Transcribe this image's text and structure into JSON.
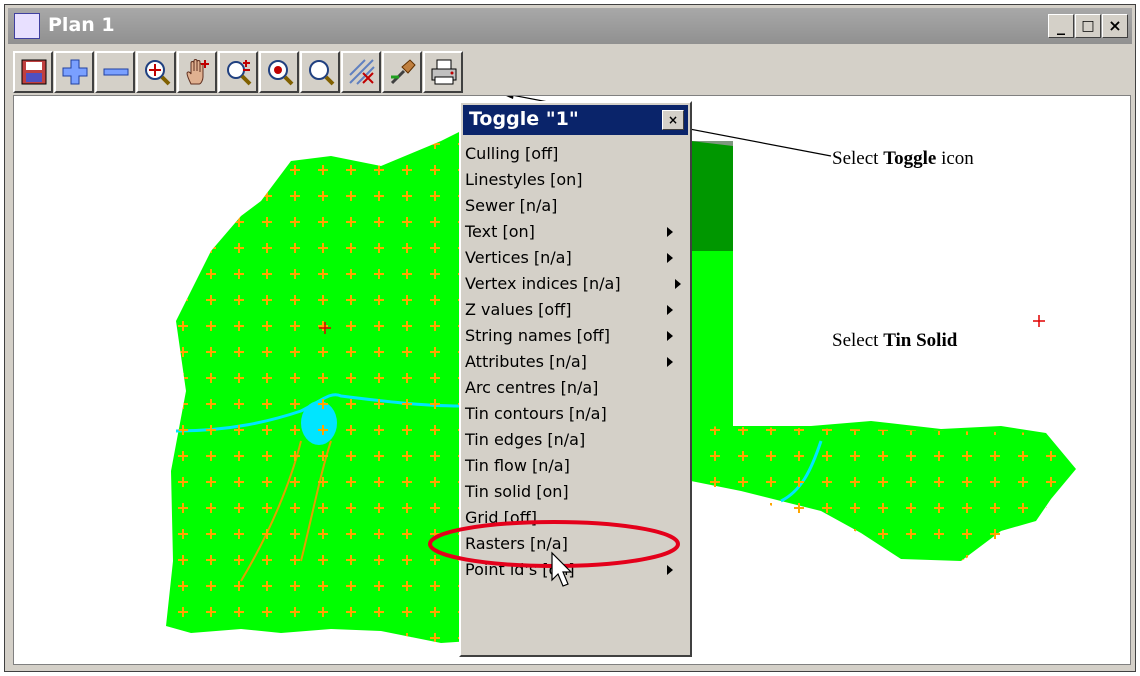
{
  "window": {
    "title": "Plan 1",
    "controls": [
      "_",
      "□",
      "×"
    ]
  },
  "toolbar": {
    "buttons": [
      {
        "name": "save-icon"
      },
      {
        "name": "zoom-in-plus-icon"
      },
      {
        "name": "zoom-out-minus-icon"
      },
      {
        "name": "zoom-extent-icon"
      },
      {
        "name": "pan-hand-icon"
      },
      {
        "name": "zoom-step-icon"
      },
      {
        "name": "zoom-center-icon"
      },
      {
        "name": "zoom-magnify-icon"
      },
      {
        "name": "toggle-icon"
      },
      {
        "name": "tool-icon"
      },
      {
        "name": "print-icon"
      }
    ]
  },
  "menu": {
    "title": "Toggle \"1\"",
    "close": "×",
    "items": [
      {
        "label": "Culling [off]",
        "submenu": false
      },
      {
        "label": "Linestyles [on]",
        "submenu": false
      },
      {
        "label": "Sewer [n/a]",
        "submenu": false
      },
      {
        "label": "Text [on]",
        "submenu": true
      },
      {
        "label": "Vertices [n/a]",
        "submenu": true
      },
      {
        "label": "Vertex indices [n/a]",
        "submenu": true
      },
      {
        "label": "Z values [off]",
        "submenu": true
      },
      {
        "label": "String names [off]",
        "submenu": true
      },
      {
        "label": "Attributes [n/a]",
        "submenu": true
      },
      {
        "label": "Arc centres [n/a]",
        "submenu": false
      },
      {
        "label": "Tin contours [n/a]",
        "submenu": false
      },
      {
        "label": "Tin edges [n/a]",
        "submenu": false
      },
      {
        "label": "Tin flow [n/a]",
        "submenu": false
      },
      {
        "label": "Tin solid [on]",
        "submenu": false
      },
      {
        "label": "Grid [off]",
        "submenu": false
      },
      {
        "label": "Rasters [n/a]",
        "submenu": false
      },
      {
        "label": "Point id's [on]",
        "submenu": true
      }
    ]
  },
  "callouts": {
    "toggle": {
      "prefix": "Select ",
      "bold": "Toggle",
      "suffix": " icon"
    },
    "tin": {
      "prefix": "Select ",
      "bold": "Tin Solid",
      "suffix": ""
    }
  },
  "colors": {
    "terrain": "#00ff00",
    "points": "#ffa500",
    "water": "#00e5ff",
    "highlight": "#e4001b",
    "titlebar": "#0a246a"
  }
}
